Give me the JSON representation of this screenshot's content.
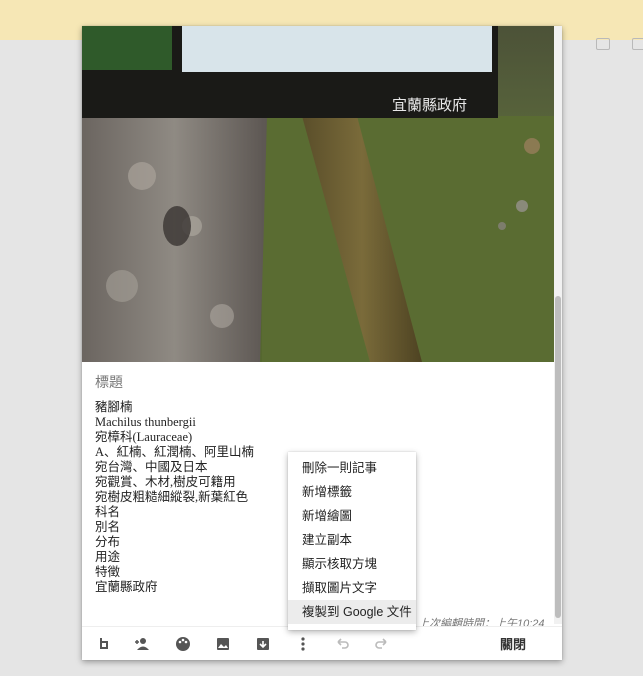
{
  "photo": {
    "sign_text": "宜蘭縣政府"
  },
  "note": {
    "title": "標題",
    "lines": [
      "豬腳楠",
      "Machilus thunbergii",
      "宛樟科(Lauraceae)",
      "A、紅楠、紅潤楠、阿里山楠",
      "宛台灣、中國及日本",
      "宛觀賞、木材,樹皮可籍用",
      "宛樹皮粗糙細縱裂,新葉紅色",
      "科名",
      "別名",
      "分布",
      "用途",
      "特徵",
      "宜蘭縣政府"
    ],
    "edited_text": "上次編輯時間：上午10:24"
  },
  "menu": {
    "items": [
      "刪除一則記事",
      "新增標籤",
      "新增繪圖",
      "建立副本",
      "顯示核取方塊",
      "擷取圖片文字",
      "複製到 Google 文件"
    ],
    "highlighted_index": 6
  },
  "toolbar": {
    "icons": [
      "remind-me-icon",
      "collaborator-icon",
      "palette-icon",
      "add-image-icon",
      "archive-icon",
      "more-vert-icon",
      "undo-icon",
      "redo-icon"
    ],
    "close_label": "關閉"
  },
  "colors": {
    "top_band": "#f6e7b5",
    "page_bg": "#e5e5e5",
    "menu_highlight": "#ececec"
  }
}
